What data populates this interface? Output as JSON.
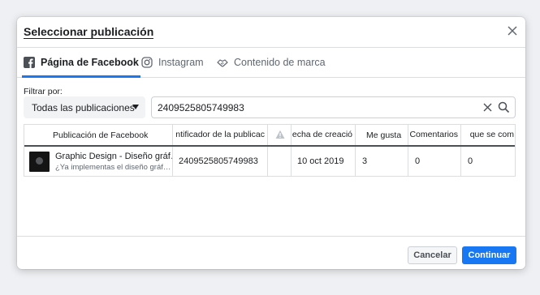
{
  "dialog": {
    "title": "Seleccionar publicación"
  },
  "tabs": [
    {
      "label": "Página de Facebook",
      "icon": "facebook-icon",
      "active": true
    },
    {
      "label": "Instagram",
      "icon": "instagram-icon",
      "active": false
    },
    {
      "label": "Contenido de marca",
      "icon": "handshake-icon",
      "active": false
    }
  ],
  "filter": {
    "label": "Filtrar por:",
    "dropdown_value": "Todas las publicaciones",
    "search_value": "2409525805749983"
  },
  "table": {
    "headers": {
      "post": "Publicación de Facebook",
      "id": "ntificador de la publicac",
      "warning": "warning-icon",
      "date": "echa de creació",
      "likes": "Me gusta",
      "comments": "Comentarios",
      "shares": "que se com"
    },
    "rows": [
      {
        "post_title": "Graphic Design - Diseño gráf…",
        "post_sub": "¿Ya implementas el diseño gráf…",
        "id": "2409525805749983",
        "warning": "",
        "date": "10 oct 2019",
        "likes": "3",
        "comments": "0",
        "shares": "0"
      }
    ]
  },
  "footer": {
    "cancel_label": "Cancelar",
    "continue_label": "Continuar"
  },
  "colors": {
    "accent": "#1877f2",
    "border": "#dadde1",
    "text": "#1c1e21",
    "muted": "#606770"
  }
}
